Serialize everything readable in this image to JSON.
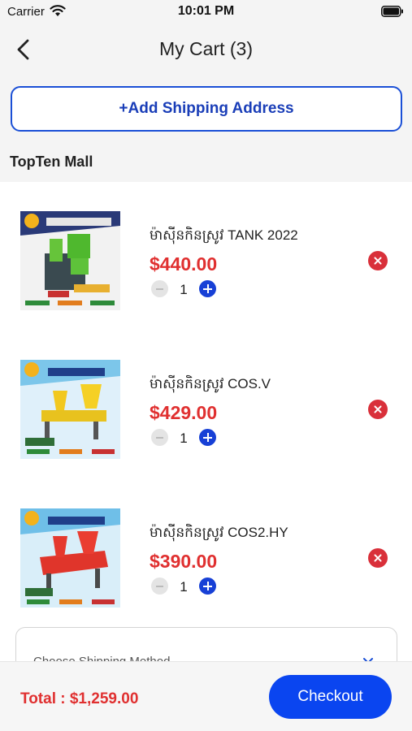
{
  "status_bar": {
    "carrier": "Carrier",
    "time": "10:01 PM"
  },
  "header": {
    "title": "My Cart (3)",
    "back_icon": "chevron-left-icon"
  },
  "address": {
    "add_label": "+Add Shipping Address"
  },
  "store": {
    "name": "TopTen Mall"
  },
  "cart": {
    "items": [
      {
        "name": "ម៉ាស៊ីនកិនស្រូវ TANK 2022",
        "price": "$440.00",
        "quantity": "1"
      },
      {
        "name": "ម៉ាស៊ីនកិនស្រូវ COS.V",
        "price": "$429.00",
        "quantity": "1"
      },
      {
        "name": "ម៉ាស៊ីនកិនស្រូវ COS2.HY",
        "price": "$390.00",
        "quantity": "1"
      }
    ]
  },
  "shipping": {
    "method_label": "Choose Shipping Method"
  },
  "footer": {
    "total": "Total : $1,259.00",
    "checkout_label": "Checkout"
  },
  "colors": {
    "accent": "#0a45f0",
    "price": "#e03030",
    "remove": "#d9303a"
  }
}
